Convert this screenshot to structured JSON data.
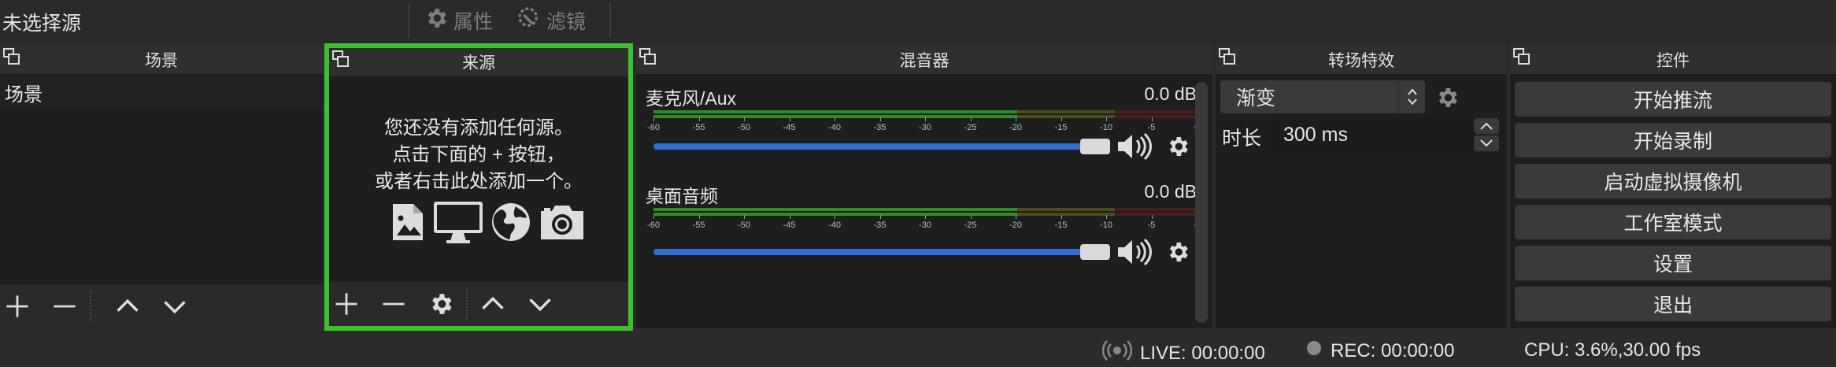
{
  "top": {
    "title": "未选择源",
    "properties_label": "属性",
    "filters_label": "滤镜"
  },
  "docks": {
    "scenes": {
      "title": "场景",
      "items": [
        "场景"
      ]
    },
    "sources": {
      "title": "来源",
      "empty_line1": "您还没有添加任何源。",
      "empty_line2": "点击下面的 + 按钮，",
      "empty_line3": "或者右击此处添加一个。"
    },
    "mixer": {
      "title": "混音器",
      "tick_labels": [
        "-60",
        "-55",
        "-50",
        "-45",
        "-40",
        "-35",
        "-30",
        "-25",
        "-20",
        "-15",
        "-10",
        "-5",
        "0"
      ],
      "tracks": [
        {
          "name": "麦克风/Aux",
          "db": "0.0 dB",
          "level_fraction": 0.84
        },
        {
          "name": "桌面音频",
          "db": "0.0 dB",
          "level_fraction": 0.84
        }
      ]
    },
    "transitions": {
      "title": "转场特效",
      "selected": "渐变",
      "duration_label": "时长",
      "duration_value": "300 ms"
    },
    "controls": {
      "title": "控件",
      "buttons": [
        "开始推流",
        "开始录制",
        "启动虚拟摄像机",
        "工作室模式",
        "设置",
        "退出"
      ]
    }
  },
  "status": {
    "live": "LIVE: 00:00:00",
    "rec": "REC: 00:00:00",
    "cpu": "CPU: 3.6%,30.00 fps"
  },
  "colors": {
    "accent_border": "#3fbf2f",
    "fader_blue": "#2f6fd6",
    "meter_green": "#3fbf2f",
    "meter_yellow": "#c8b73a",
    "meter_red": "#b03030"
  }
}
